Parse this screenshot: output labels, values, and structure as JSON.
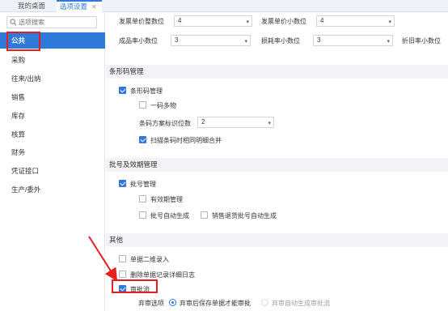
{
  "tabs": [
    {
      "label": "我的桌面"
    },
    {
      "label": "选项设置",
      "close": "✕"
    }
  ],
  "sidebar": {
    "search_placeholder": "选项搜索",
    "items": [
      {
        "label": "公共"
      },
      {
        "label": "采购"
      },
      {
        "label": "往来/出纳"
      },
      {
        "label": "销售"
      },
      {
        "label": "库存"
      },
      {
        "label": "核算"
      },
      {
        "label": "财务"
      },
      {
        "label": "凭证接口"
      },
      {
        "label": "生产/委外"
      }
    ]
  },
  "settings_top": {
    "invoice_price_int_label": "发票单价整数位",
    "invoice_price_int_value": "4",
    "invoice_price_dec_label": "发票单价小数位",
    "invoice_price_dec_value": "4",
    "finished_rate_label": "成品率小数位",
    "finished_rate_value": "3",
    "loss_rate_label": "损耗率小数位",
    "loss_rate_value": "3",
    "depreciation_label": "折旧率小数位"
  },
  "barcode": {
    "title": "条形码管理",
    "manage_label": "条形码管理",
    "multi_label": "一码多物",
    "digits_label": "条码方案标识位数",
    "digits_value": "2",
    "scan_label": "扫描条码时相同明细合并"
  },
  "batch": {
    "title": "批号及效期管理",
    "manage_label": "批号管理",
    "expiry_label": "有效期管理",
    "auto_label": "批号自动生成",
    "return_label": "销售退货批号自动生成"
  },
  "other": {
    "title": "其他",
    "twod_label": "单据二维录入",
    "delete_log_label": "删除单据记录详细日志",
    "approval_label": "审批流",
    "audit_option_label": "弃审选项",
    "audit_opt1": "弃审后保存单据才能审批",
    "audit_opt2": "弃审自动生成审批流"
  },
  "colors": {
    "accent": "#2f79d8",
    "highlight": "#e32020"
  }
}
